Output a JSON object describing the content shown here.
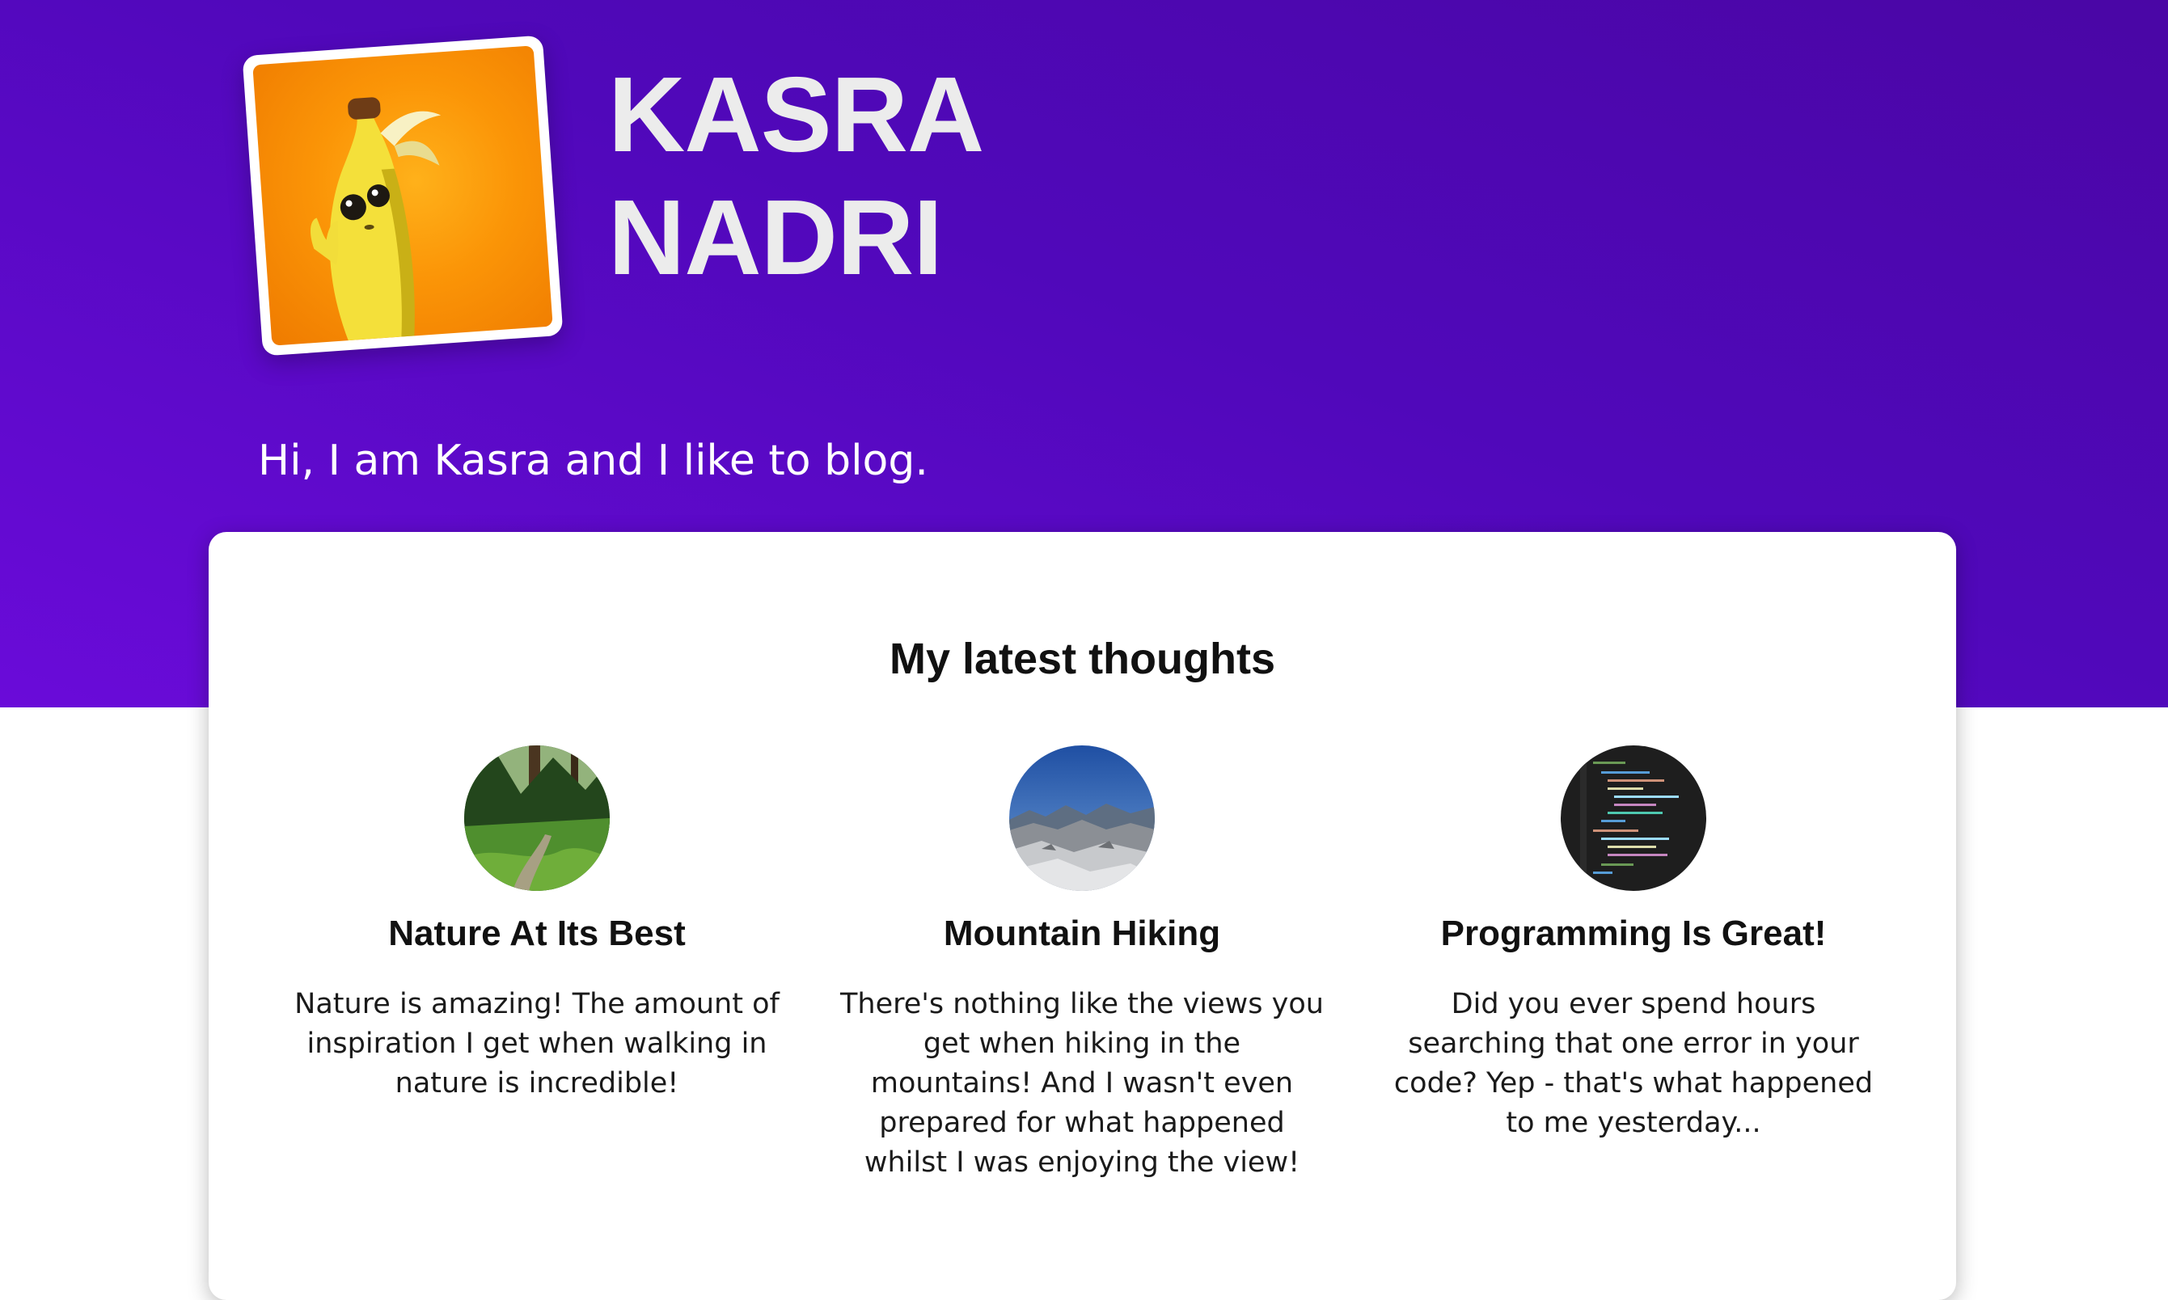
{
  "header": {
    "name_line_1": "KASRA",
    "name_line_2": "NADRI",
    "tagline": "Hi, I am Kasra and I like to blog."
  },
  "latest": {
    "heading": "My latest thoughts",
    "posts": [
      {
        "title": "Nature At Its Best",
        "excerpt": "Nature is amazing! The amount of inspiration I get when walking in nature is incredible!"
      },
      {
        "title": "Mountain Hiking",
        "excerpt": "There's nothing like the views you get when hiking in the mountains! And I wasn't even prepared for what happened whilst I was enjoying the view!"
      },
      {
        "title": "Programming Is Great!",
        "excerpt": "Did you ever spend hours searching that one error in your code? Yep - that's what happened to me yesterday..."
      }
    ]
  },
  "colors": {
    "hero_top": "#4a06a5",
    "hero_bottom": "#6a0bd9",
    "title_text": "#ececec"
  }
}
